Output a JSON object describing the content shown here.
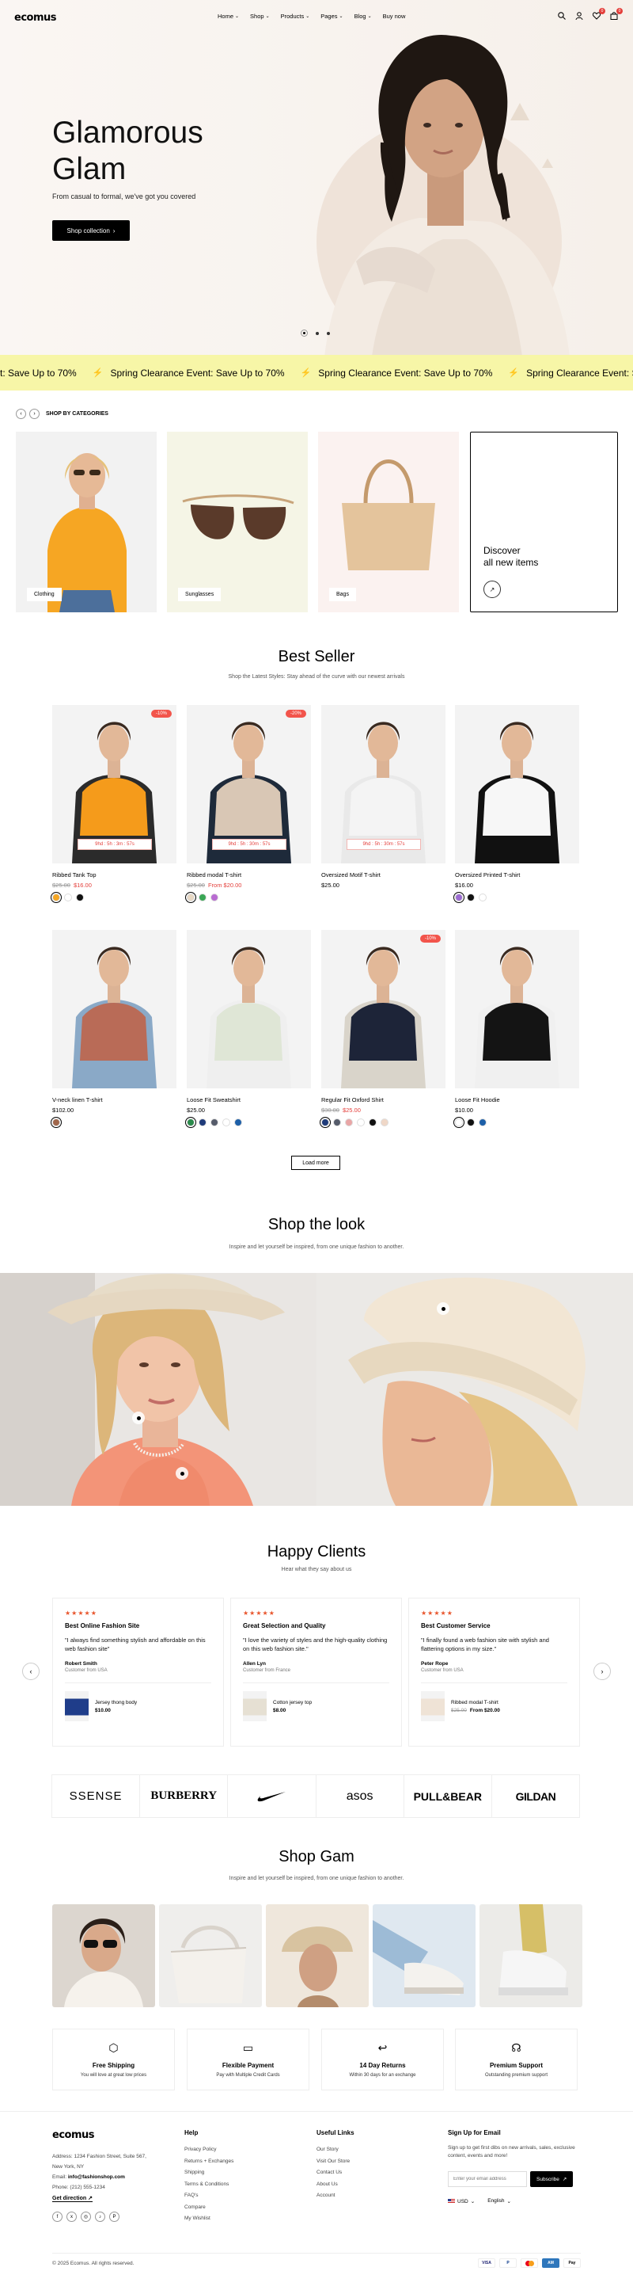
{
  "header": {
    "logo": "ecomus",
    "nav": [
      {
        "label": "Home",
        "chevron": true
      },
      {
        "label": "Shop",
        "chevron": true
      },
      {
        "label": "Products",
        "chevron": true
      },
      {
        "label": "Pages",
        "chevron": true
      },
      {
        "label": "Blog",
        "chevron": true
      },
      {
        "label": "Buy now",
        "chevron": false
      }
    ],
    "wishlist_count": "0",
    "cart_count": "0"
  },
  "hero": {
    "title_line1": "Glamorous",
    "title_line2": "Glam",
    "subtitle": "From casual to formal, we've got you covered",
    "button_label": "Shop collection",
    "slides": 3,
    "active_slide": 1
  },
  "marquee": {
    "items": [
      "t: Save Up to 70%",
      "Spring Clearance Event: Save Up to 70%",
      "Spring Clearance Event: Save Up to 70%",
      "Spring Clearance Event: Save Up to 70%"
    ]
  },
  "categories": {
    "heading": "SHOP BY CATEGORIES",
    "items": [
      {
        "label": "Clothing",
        "bg": "#f2f2f2"
      },
      {
        "label": "Sunglasses",
        "bg": "#f5f5e6"
      },
      {
        "label": "Bags",
        "bg": "#fbf2f0"
      }
    ],
    "discover_line1": "Discover",
    "discover_line2": "all new items"
  },
  "best_seller": {
    "title": "Best Seller",
    "subtitle": "Shop the Latest Styles: Stay ahead of the curve with our newest arrivals",
    "products": [
      {
        "name": "Ribbed Tank Top",
        "old_price": "$25.00",
        "price": "$16.00",
        "discount": "-10%",
        "sale": "9hd : 5h : 3m : 57s",
        "swatches": [
          "#f5a623",
          "#ffffff",
          "#111111"
        ],
        "top": "#f59b1b",
        "bottom": "#2b2b2b"
      },
      {
        "name": "Ribbed modal T-shirt",
        "old_price": "$25.00",
        "price": "From $20.00",
        "discount": "-20%",
        "sale": "9hd : 5h : 30m : 57s",
        "swatches": [
          "#e8d8c4",
          "#3aa655",
          "#b86bd1"
        ],
        "top": "#d9c7b5",
        "bottom": "#1e2a3a"
      },
      {
        "name": "Oversized Motif T-shirt",
        "old_price": "",
        "price": "$25.00",
        "discount": "",
        "sale": "9hd : 5h : 30m : 57s",
        "swatches": [],
        "top": "#f4f4f4",
        "bottom": "#e9e9e9"
      },
      {
        "name": "Oversized Printed T-shirt",
        "old_price": "",
        "price": "$16.00",
        "discount": "",
        "sale": "",
        "swatches": [
          "#9b6bd1",
          "#111111",
          "#ffffff"
        ],
        "top": "#f7f7f7",
        "bottom": "#111111"
      },
      {
        "name": "V-neck linen T-shirt",
        "old_price": "",
        "price": "$102.00",
        "discount": "",
        "sale": "",
        "swatches": [
          "#a0664b"
        ],
        "top": "#b96b57",
        "bottom": "#8aa9c7"
      },
      {
        "name": "Loose Fit Sweatshirt",
        "old_price": "",
        "price": "$25.00",
        "discount": "",
        "sale": "",
        "swatches": [
          "#2a8a4b",
          "#1f3b7a",
          "#555b6a",
          "#ffffff",
          "#1d5fa8"
        ],
        "top": "#dfe6d6",
        "bottom": "#efefef"
      },
      {
        "name": "Regular Fit Oxford Shirt",
        "old_price": "$30.00",
        "price": "$25.00",
        "discount": "-10%",
        "sale": "",
        "swatches": [
          "#1f3b7a",
          "#555b6a",
          "#e9a6a6",
          "#ffffff",
          "#111111",
          "#efd7c7"
        ],
        "top": "#1d2438",
        "bottom": "#d9d4ca"
      },
      {
        "name": "Loose Fit Hoodie",
        "old_price": "",
        "price": "$10.00",
        "discount": "",
        "sale": "",
        "swatches": [
          "#ffffff",
          "#111111",
          "#1d5fa8"
        ],
        "top": "#141414",
        "bottom": "#f0f0f0"
      }
    ],
    "load_more": "Load more"
  },
  "shop_look": {
    "title": "Shop the look",
    "subtitle": "Inspire and let yourself be inspired, from one unique fashion to another."
  },
  "clients": {
    "title": "Happy Clients",
    "subtitle": "Hear what they say about us",
    "stars": "★★★★★",
    "items": [
      {
        "title": "Best Online Fashion Site",
        "quote": "\"I always find something stylish and affordable on this web fashion site\"",
        "name": "Robert Smith",
        "loc": "Customer from USA",
        "product": "Jersey thong body",
        "old_price": "",
        "price": "$10.00",
        "thumb": "#1f3d8a"
      },
      {
        "title": "Great Selection and Quality",
        "quote": "\"I love the variety of styles and the high-quality clothing on this web fashion site.\"",
        "name": "Allen Lyn",
        "loc": "Customer from France",
        "product": "Cotton jersey top",
        "old_price": "",
        "price": "$8.00",
        "thumb": "#e6e0d3"
      },
      {
        "title": "Best Customer Service",
        "quote": "\"I finally found a web fashion site with stylish and flattering options in my size.\"",
        "name": "Peter Rope",
        "loc": "Customer from USA",
        "product": "Ribbed modal T-shirt",
        "old_price": "$25.00",
        "price": "From $20.00",
        "thumb": "#efe3d6"
      }
    ]
  },
  "brands": [
    "SSENSE",
    "BURBERRY",
    "nike-swoosh",
    "asos",
    "PULL&BEAR",
    "GILDAN"
  ],
  "gallery": {
    "title": "Shop Gam",
    "subtitle": "Inspire and let yourself be inspired, from one unique fashion to another."
  },
  "features": [
    {
      "icon": "box-icon",
      "title": "Free Shipping",
      "sub": "You will love at great low prices"
    },
    {
      "icon": "card-icon",
      "title": "Flexible Payment",
      "sub": "Pay with Multiple Credit Cards"
    },
    {
      "icon": "return-icon",
      "title": "14 Day Returns",
      "sub": "Within 30 days for an exchange"
    },
    {
      "icon": "support-icon",
      "title": "Premium Support",
      "sub": "Outstanding premium support"
    }
  ],
  "footer": {
    "logo": "ecomus",
    "address": "Address: 1234 Fashion Street, Suite 567,",
    "city": "New York, NY",
    "email_label": "Email: ",
    "email": "info@fashionshop.com",
    "phone": "Phone: (212) 555-1234",
    "direction": "Get direction",
    "help_title": "Help",
    "help_links": [
      "Privacy Policy",
      "Returns + Exchanges",
      "Shipping",
      "Terms & Conditions",
      "FAQ's",
      "Compare",
      "My Wishlist"
    ],
    "useful_title": "Useful Links",
    "useful_links": [
      "Our Story",
      "Visit Our Store",
      "Contact Us",
      "About Us",
      "Account"
    ],
    "signup_title": "Sign Up for Email",
    "signup_text": "Sign up to get first dibs on new arrivals, sales, exclusive content, events and more!",
    "email_placeholder": "Enter your email address",
    "subscribe": "Subscribe",
    "currency": "USD",
    "language": "English",
    "copyright": "© 2025 Ecomus. All rights reserved.",
    "payments": [
      "VISA",
      "PayPal",
      "MC",
      "AMEX",
      "Pay"
    ]
  }
}
